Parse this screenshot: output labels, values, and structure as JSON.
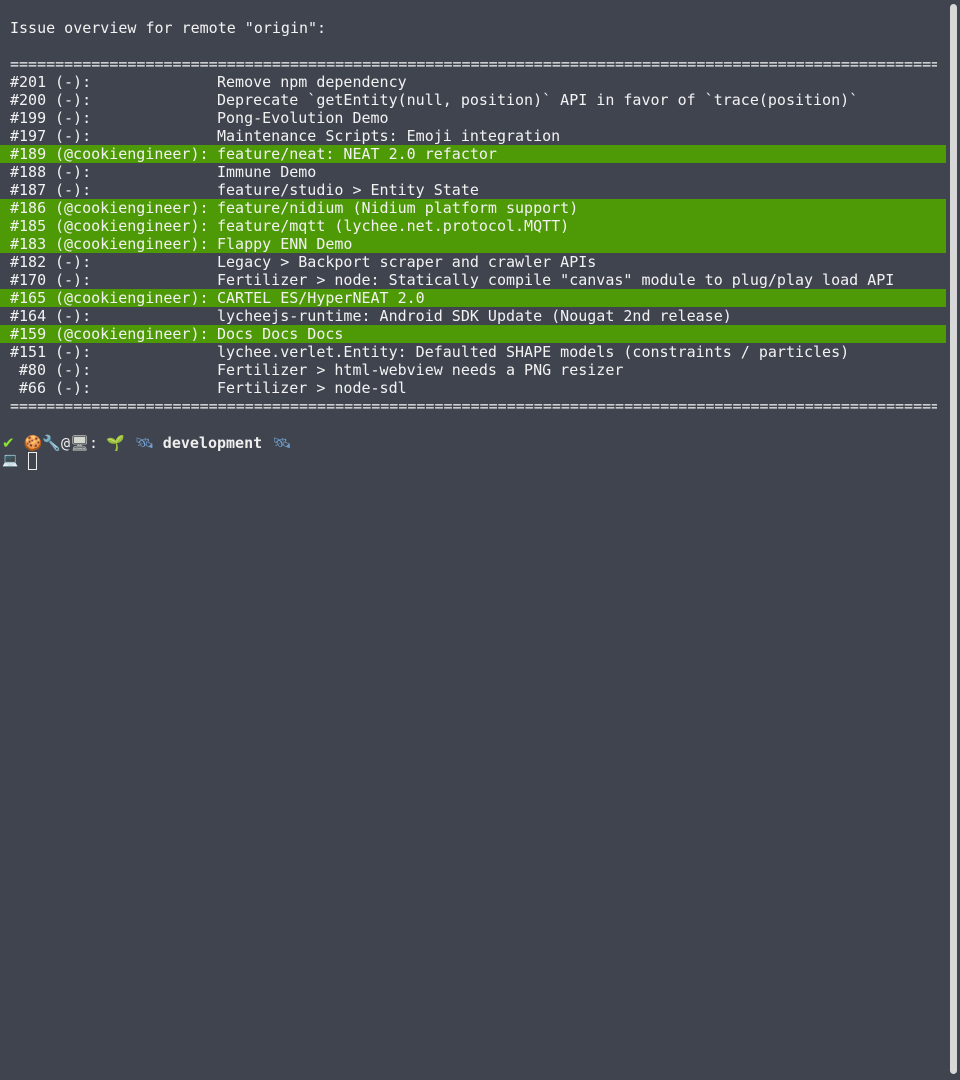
{
  "header": "Issue overview for remote \"origin\":",
  "separator": "==========================================================================================================",
  "issues": [
    {
      "number": "#201",
      "author": "(-):",
      "title": "Remove npm dependency",
      "highlighted": false
    },
    {
      "number": "#200",
      "author": "(-):",
      "title": "Deprecate `getEntity(null, position)` API in favor of `trace(position)`",
      "highlighted": false
    },
    {
      "number": "#199",
      "author": "(-):",
      "title": "Pong-Evolution Demo",
      "highlighted": false
    },
    {
      "number": "#197",
      "author": "(-):",
      "title": "Maintenance Scripts: Emoji integration",
      "highlighted": false
    },
    {
      "number": "#189",
      "author": "(@cookiengineer):",
      "title": "feature/neat: NEAT 2.0 refactor",
      "highlighted": true
    },
    {
      "number": "#188",
      "author": "(-):",
      "title": "Immune Demo",
      "highlighted": false
    },
    {
      "number": "#187",
      "author": "(-):",
      "title": "feature/studio > Entity State",
      "highlighted": false
    },
    {
      "number": "#186",
      "author": "(@cookiengineer):",
      "title": "feature/nidium (Nidium platform support)",
      "highlighted": true
    },
    {
      "number": "#185",
      "author": "(@cookiengineer):",
      "title": "feature/mqtt (lychee.net.protocol.MQTT)",
      "highlighted": true
    },
    {
      "number": "#183",
      "author": "(@cookiengineer):",
      "title": "Flappy ENN Demo",
      "highlighted": true
    },
    {
      "number": "#182",
      "author": "(-):",
      "title": "Legacy > Backport scraper and crawler APIs",
      "highlighted": false
    },
    {
      "number": "#170",
      "author": "(-):",
      "title": "Fertilizer > node: Statically compile \"canvas\" module to plug/play load API",
      "highlighted": false
    },
    {
      "number": "#165",
      "author": "(@cookiengineer):",
      "title": "CARTEL ES/HyperNEAT 2.0",
      "highlighted": true
    },
    {
      "number": "#164",
      "author": "(-):",
      "title": "lycheejs-runtime: Android SDK Update (Nougat 2nd release)",
      "highlighted": false
    },
    {
      "number": "#159",
      "author": "(@cookiengineer):",
      "title": "Docs Docs Docs",
      "highlighted": true
    },
    {
      "number": "#151",
      "author": "(-):",
      "title": "lychee.verlet.Entity: Defaulted SHAPE models (constraints / particles)",
      "highlighted": false
    },
    {
      "number": "#80",
      "author": "(-):",
      "title": "Fertilizer > html-webview needs a PNG resizer",
      "highlighted": false
    },
    {
      "number": "#66",
      "author": "(-):",
      "title": "Fertilizer > node-sdl",
      "highlighted": false
    }
  ],
  "prompt": {
    "status_icon": "✔",
    "user_icon": "🍪",
    "tools_icon": "🔧",
    "at": "@",
    "host_icon": "🖥",
    "colon": ":",
    "dir_icon": "🌱",
    "branch_icon_left": "🛰",
    "branch": "development",
    "branch_icon_right": "🛰",
    "input_icon": "💻"
  },
  "colors": {
    "background": "#3f444f",
    "text": "#f2f2f2",
    "highlight": "#4e9a06"
  }
}
